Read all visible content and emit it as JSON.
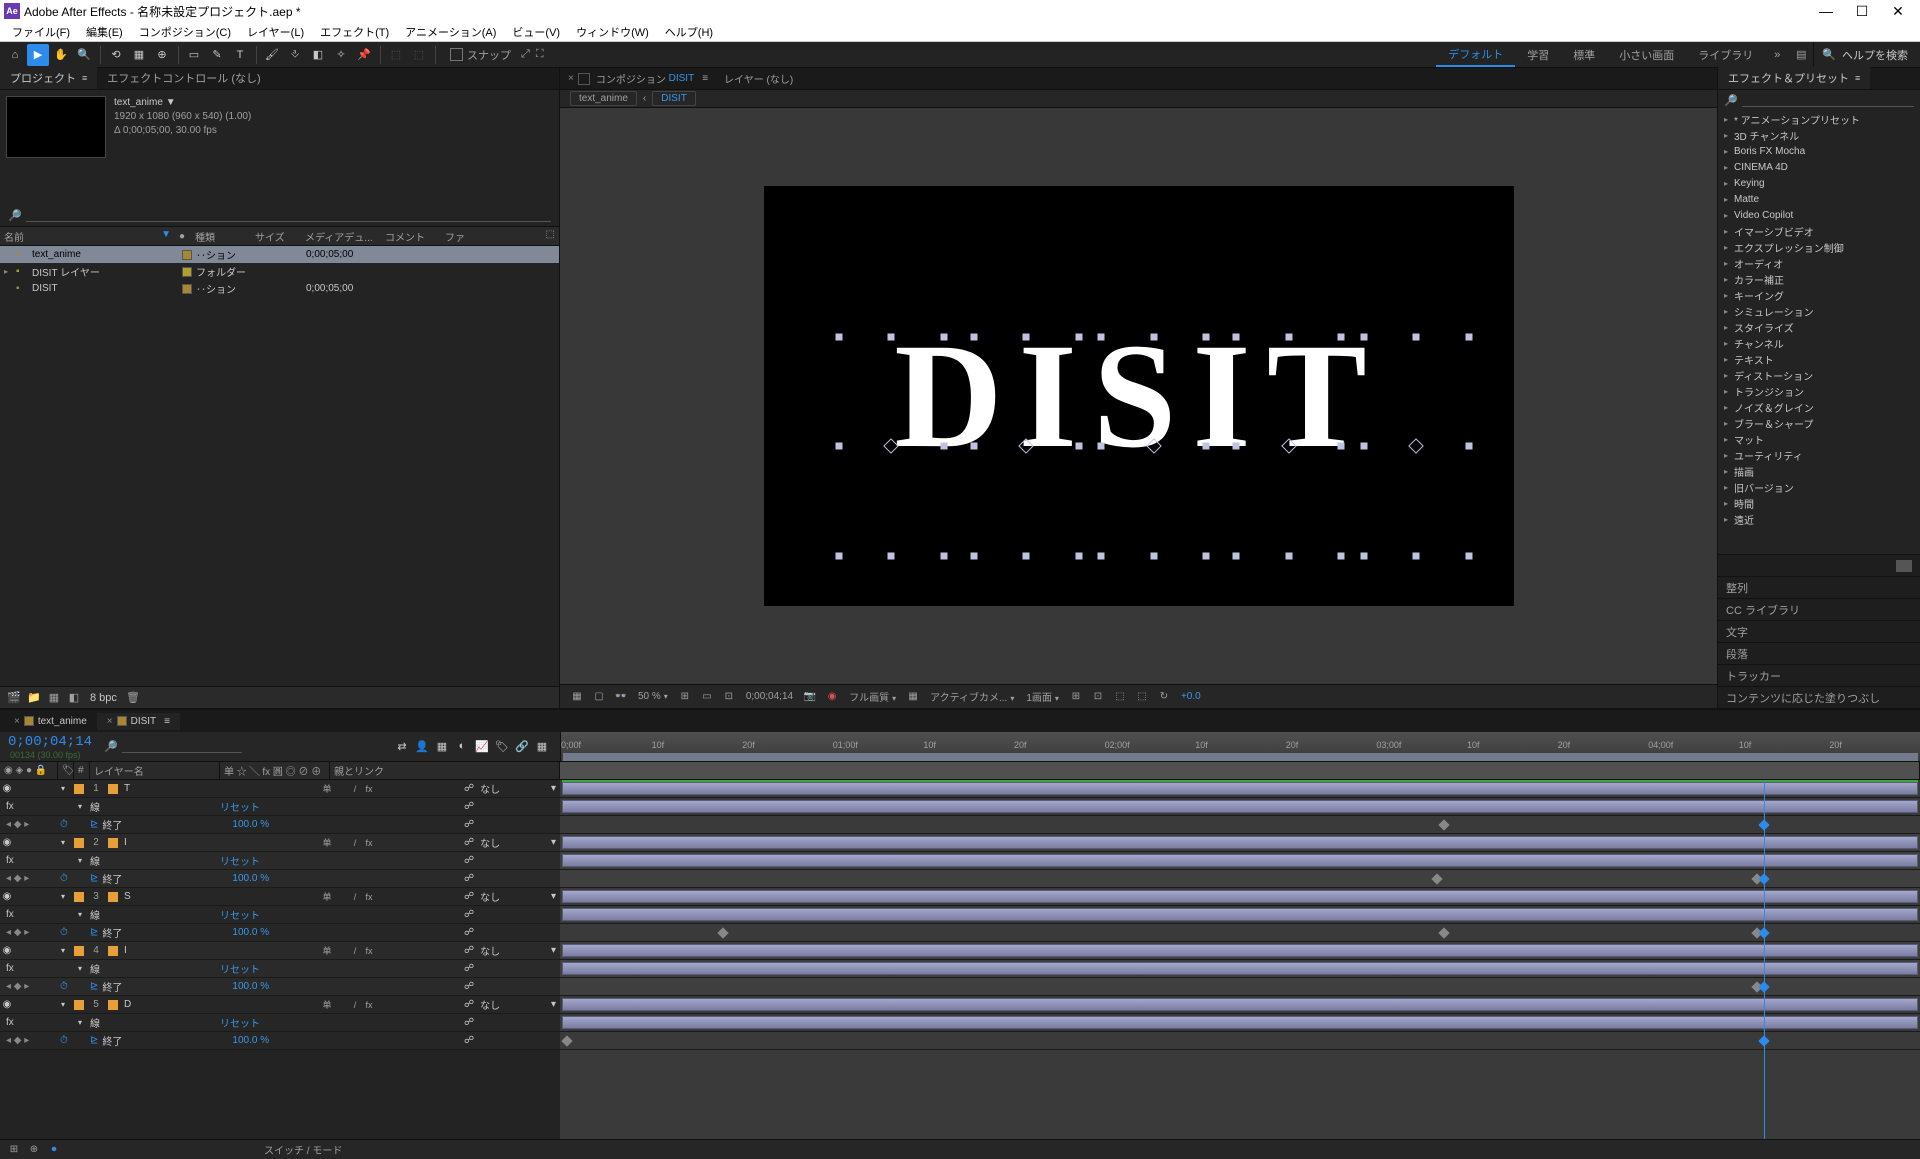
{
  "window": {
    "title": "Adobe After Effects - 名称未設定プロジェクト.aep *",
    "appShort": "Ae"
  },
  "menu": [
    "ファイル(F)",
    "編集(E)",
    "コンポジション(C)",
    "レイヤー(L)",
    "エフェクト(T)",
    "アニメーション(A)",
    "ビュー(V)",
    "ウィンドウ(W)",
    "ヘルプ(H)"
  ],
  "toolbar": {
    "snap": "スナップ",
    "workspaces": [
      "デフォルト",
      "学習",
      "標準",
      "小さい画面",
      "ライブラリ"
    ],
    "activeWs": "デフォルト",
    "searchPlaceholder": "ヘルプを検索"
  },
  "projectPanel": {
    "tabProject": "プロジェクト",
    "tabEffectControls": "エフェクトコントロール (なし)",
    "meta": {
      "name": "text_anime ▼",
      "res": "1920 x 1080  (960 x 540) (1.00)",
      "dur": "Δ 0;00;05;00, 30.00 fps"
    },
    "cols": {
      "name": "名前",
      "tag": "●",
      "type": "種類",
      "size": "サイズ",
      "media": "メディアデュ...",
      "comment": "コメント",
      "file": "ファ"
    },
    "rows": [
      {
        "indent": 0,
        "twisty": "",
        "name": "text_anime",
        "type": "‥ション",
        "dur": "0;00;05;00",
        "selected": true,
        "color": "#a88632"
      },
      {
        "indent": 0,
        "twisty": "▸",
        "name": "DISIT レイヤー",
        "type": "フォルダー",
        "dur": "",
        "color": "#b0a030"
      },
      {
        "indent": 0,
        "twisty": "",
        "name": "DISIT",
        "type": "‥ション",
        "dur": "0;00;05;00",
        "color": "#a88632"
      }
    ],
    "bpc": "8 bpc"
  },
  "comp": {
    "tabPrefix": "コンポジション",
    "tabLink": "DISIT",
    "tabMenu": "≡",
    "tabLayer": "レイヤー (なし)",
    "crumb1": "text_anime",
    "crumb2": "DISIT",
    "crumbArrow": "‹",
    "text": "DISIT",
    "viewerbar": {
      "zoom": "50 %",
      "time": "0;00;04;14",
      "quality": "フル画質",
      "camera": "アクティブカメ...",
      "view": "1画面",
      "exposure": "+0.0"
    }
  },
  "effects": {
    "tab": "エフェクト＆プリセット",
    "list": [
      "* アニメーションプリセット",
      "3D チャンネル",
      "Boris FX Mocha",
      "CINEMA 4D",
      "Keying",
      "Matte",
      "Video Copilot",
      "イマーシブビデオ",
      "エクスプレッション制御",
      "オーディオ",
      "カラー補正",
      "キーイング",
      "シミュレーション",
      "スタイライズ",
      "チャンネル",
      "テキスト",
      "ディストーション",
      "トランジション",
      "ノイズ＆グレイン",
      "ブラー＆シャープ",
      "マット",
      "ユーティリティ",
      "描画",
      "旧バージョン",
      "時間",
      "遠近"
    ],
    "sideTabs": [
      "整列",
      "CC ライブラリ",
      "文字",
      "段落",
      "トラッカー",
      "コンテンツに応じた塗りつぶし"
    ]
  },
  "timeline": {
    "tab1": "text_anime",
    "tab2": "DISIT",
    "timecode": "0;00;04;14",
    "timecodeSub": "00134 (30.00 fps)",
    "cols": {
      "layerName": "レイヤー名",
      "switches": "单 ☆ ╲ fx 圓 ◎ ⊘ ⊕",
      "parent": "親とリンク",
      "mode": "なし"
    },
    "ruler": [
      "0;00f",
      "10f",
      "20f",
      "01;00f",
      "10f",
      "20f",
      "02;00f",
      "10f",
      "20f",
      "03;00f",
      "10f",
      "20f",
      "04;00f",
      "10f",
      "20f",
      "05;00f"
    ],
    "layers": [
      {
        "n": 1,
        "name": "T",
        "color": "#e89f3a",
        "fx": true
      },
      {
        "n": 2,
        "name": "I",
        "color": "#e89f3a",
        "fx": true
      },
      {
        "n": 3,
        "name": "S",
        "color": "#e89f3a",
        "fx": true
      },
      {
        "n": 4,
        "name": "I",
        "color": "#e89f3a",
        "fx": true
      },
      {
        "n": 5,
        "name": "D",
        "color": "#e89f3a",
        "fx": true
      }
    ],
    "subLine": "線",
    "subReset": "リセット",
    "subEnd": "終了",
    "subEndVal": "100.0 %",
    "parentNone": "なし",
    "footer": "スイッチ / モード",
    "keyframePositions": [
      [
        65.0
      ],
      [
        64.5,
        88.0
      ],
      [
        12.0,
        65.0,
        88.0
      ],
      [
        88.0
      ],
      [
        0.5
      ]
    ],
    "playheadPct": 88.5
  }
}
